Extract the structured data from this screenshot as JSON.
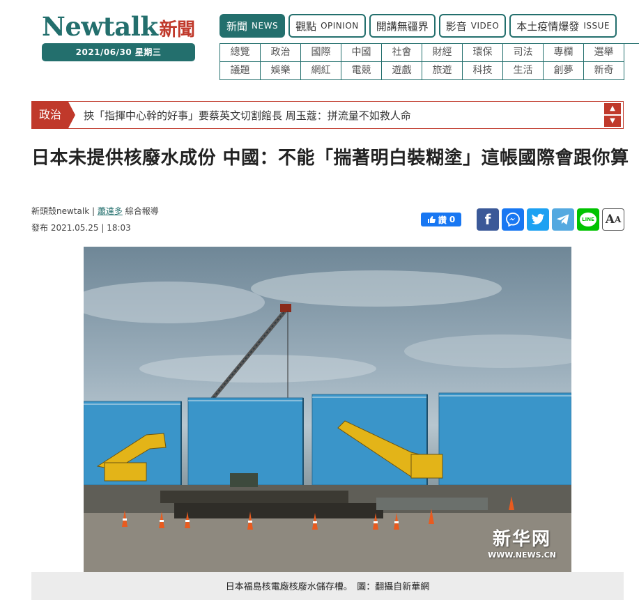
{
  "logo": {
    "word": "Newtalk",
    "cn": "新聞"
  },
  "date": "2021/06/30 星期三",
  "main_tabs": [
    {
      "cn": "新聞",
      "en": "NEWS",
      "active": true
    },
    {
      "cn": "觀點",
      "en": "OPINION",
      "active": false
    },
    {
      "cn": "開講無疆界",
      "en": "",
      "active": false
    },
    {
      "cn": "影音",
      "en": "VIDEO",
      "active": false
    },
    {
      "cn": "本土疫情爆發",
      "en": "ISSUE",
      "active": false
    }
  ],
  "categories": [
    "總覽",
    "政治",
    "國際",
    "中國",
    "社會",
    "財經",
    "環保",
    "司法",
    "專欄",
    "選舉",
    "議題",
    "娛樂",
    "網紅",
    "電競",
    "遊戲",
    "旅遊",
    "科技",
    "生活",
    "創夢",
    "新奇"
  ],
  "ticker": {
    "label": "政治",
    "text": "挾「指揮中心幹的好事」要蔡英文切割館長 周玉蔻：拼流量不如救人命",
    "up": "▲",
    "down": "▼"
  },
  "article": {
    "headline": "日本未提供核廢水成份 中國：不能「揣著明白裝糊塗」這帳國際會跟你算",
    "source": "新頭殼newtalk",
    "separator": "|",
    "author": "蕭達多",
    "report_type": "綜合報導",
    "published": "發布 2021.05.25 | 18:03"
  },
  "like": {
    "label": "讚",
    "count": "0"
  },
  "share": {
    "facebook": "f",
    "line": "LINE",
    "font_size": "A"
  },
  "photo": {
    "watermark_cn": "新华网",
    "watermark_url": "WWW.NEWS.CN"
  },
  "caption": "日本福島核電廠核廢水儲存槽。　圖：翻攝自新華網",
  "colors": {
    "brand": "#236f6d",
    "accent": "#c0392b",
    "facebook": "#3b5998",
    "like": "#1877f2"
  }
}
